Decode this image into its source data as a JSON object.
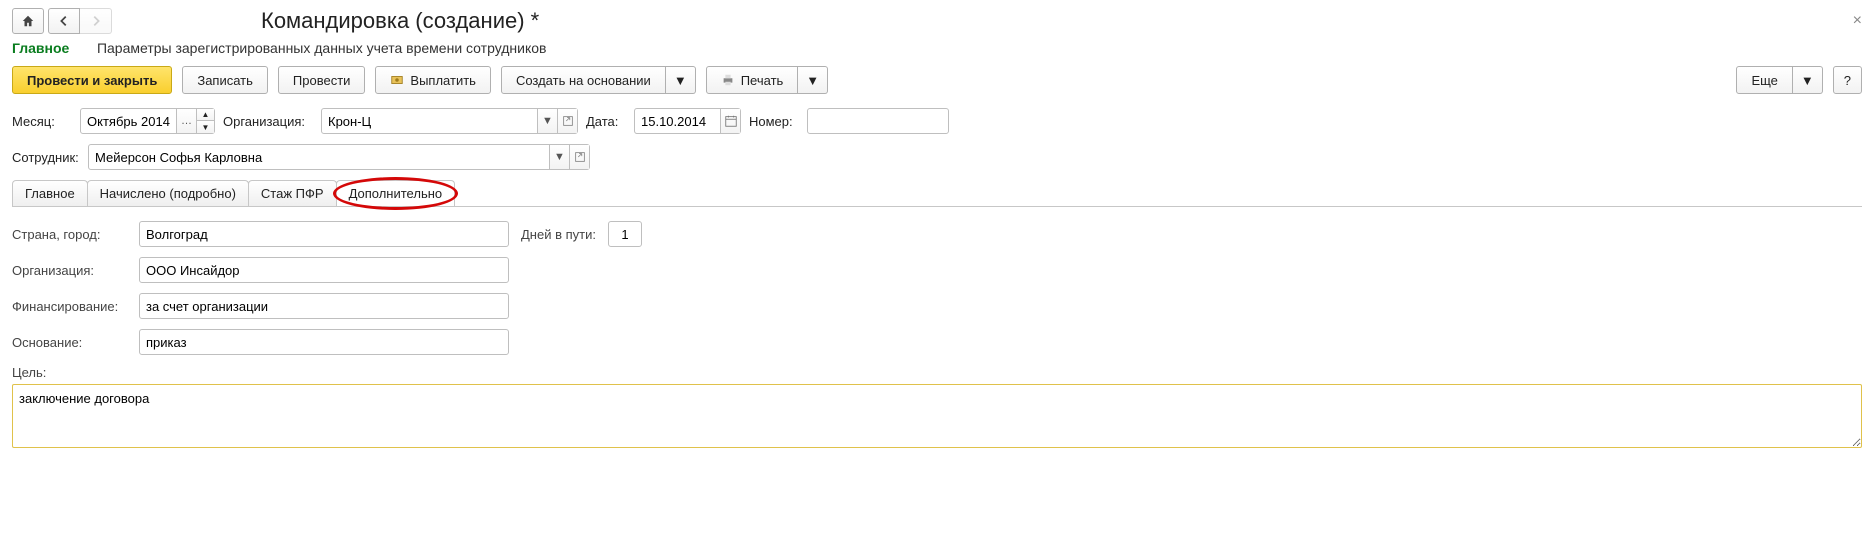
{
  "title": "Командировка (создание) *",
  "navLinks": {
    "main": "Главное",
    "params": "Параметры зарегистрированных данных учета времени сотрудников"
  },
  "toolbar": {
    "postClose": "Провести и закрыть",
    "save": "Записать",
    "post": "Провести",
    "pay": "Выплатить",
    "createFrom": "Создать на основании",
    "print": "Печать",
    "more": "Еще",
    "help": "?"
  },
  "row1": {
    "monthLabel": "Месяц:",
    "monthValue": "Октябрь 2014",
    "orgLabel": "Организация:",
    "orgValue": "Крон-Ц",
    "dateLabel": "Дата:",
    "dateValue": "15.10.2014",
    "numberLabel": "Номер:",
    "numberValue": ""
  },
  "row2": {
    "employeeLabel": "Сотрудник:",
    "employeeValue": "Мейерсон Софья Карловна"
  },
  "tabs": {
    "t1": "Главное",
    "t2": "Начислено (подробно)",
    "t3": "Стаж ПФР",
    "t4": "Дополнительно"
  },
  "add": {
    "countryCityLabel": "Страна, город:",
    "countryCityValue": "Волгоград",
    "daysRoadLabel": "Дней в пути:",
    "daysRoadValue": "1",
    "orgLabel": "Организация:",
    "orgValue": "ООО Инсайдор",
    "fundingLabel": "Финансирование:",
    "fundingValue": "за счет организации",
    "basisLabel": "Основание:",
    "basisValue": "приказ",
    "goalLabel": "Цель:",
    "goalValue": "заключение договора"
  }
}
